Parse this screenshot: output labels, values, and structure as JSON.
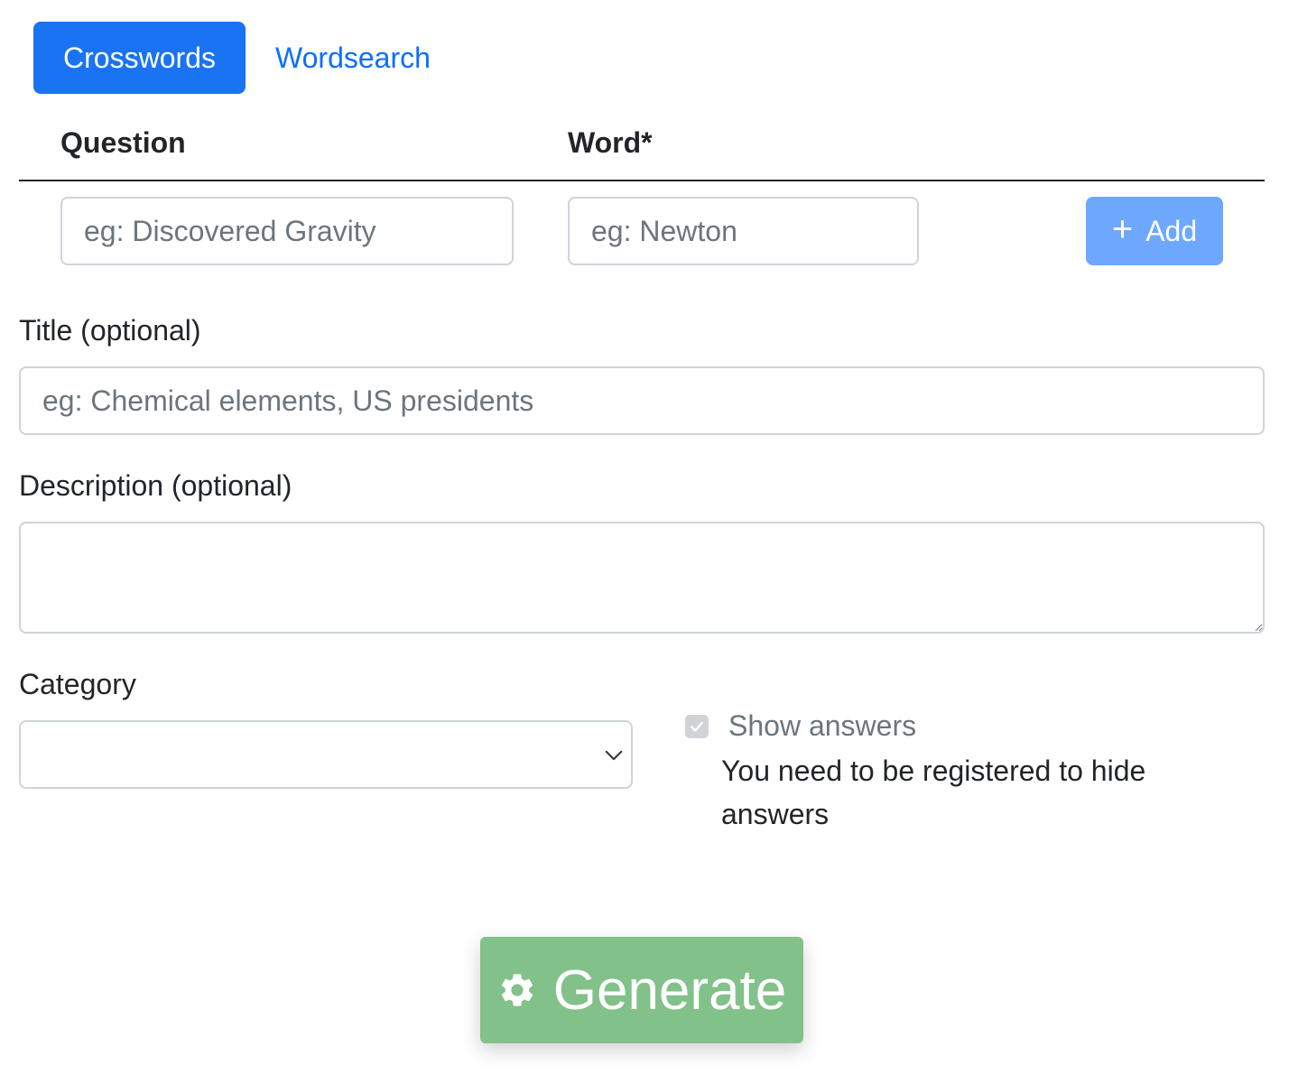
{
  "tabs": [
    {
      "label": "Crosswords",
      "active": true
    },
    {
      "label": "Wordsearch",
      "active": false
    }
  ],
  "table": {
    "question_header": "Question",
    "word_header": "Word*",
    "question_placeholder": "eg: Discovered Gravity",
    "word_placeholder": "eg: Newton",
    "add_label": "Add",
    "add_icon": "plus-icon"
  },
  "title_field": {
    "label": "Title (optional)",
    "placeholder": "eg: Chemical elements, US presidents",
    "value": ""
  },
  "description_field": {
    "label": "Description (optional)",
    "value": ""
  },
  "category": {
    "label": "Category",
    "selected": ""
  },
  "show_answers": {
    "label": "Show answers",
    "checked": true,
    "disabled": true,
    "help": "You need to be registered to hide answers"
  },
  "generate": {
    "label": "Generate",
    "icon": "gear-icon"
  },
  "colors": {
    "primary": "#1a73f2",
    "primary_light": "#6ea8fe",
    "link": "#0d6efd",
    "success_light": "#82c18a",
    "border": "#ced4da",
    "muted": "#6c757d"
  }
}
